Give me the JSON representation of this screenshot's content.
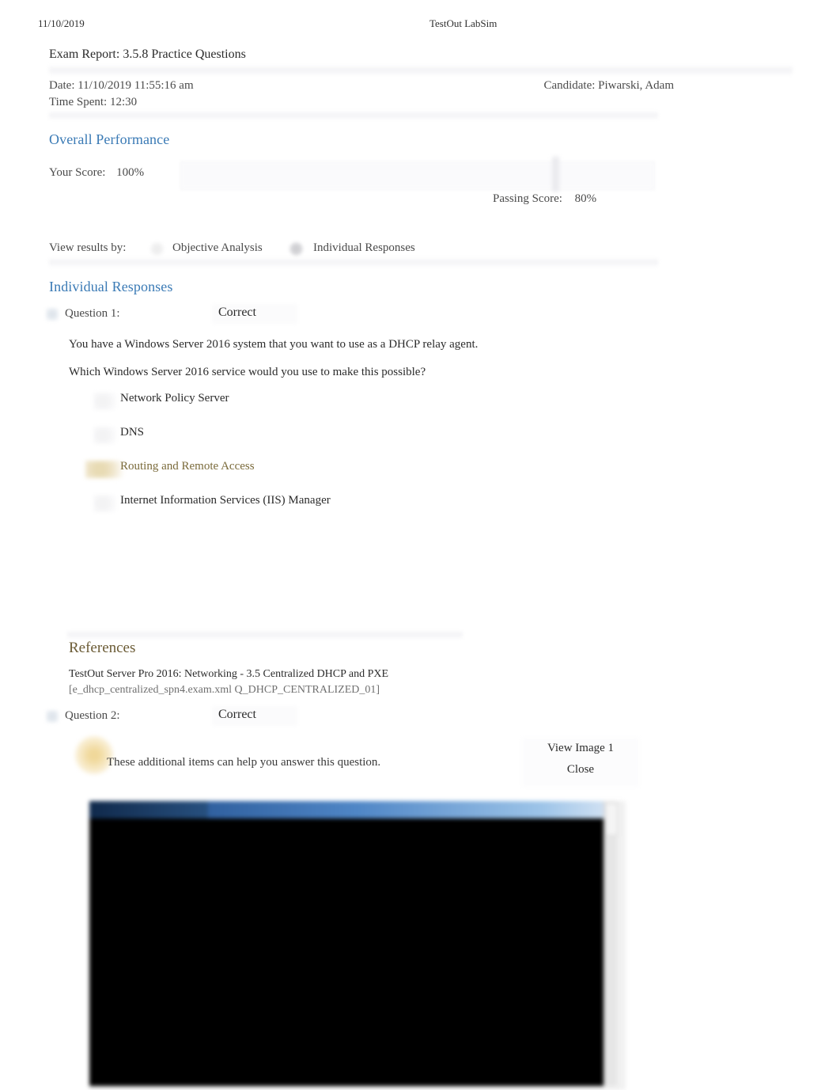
{
  "print_header": {
    "date": "11/10/2019",
    "app_title": "TestOut LabSim"
  },
  "report": {
    "title": "Exam Report: 3.5.8 Practice Questions",
    "date_label": "Date: 11/10/2019 11:55:16 am",
    "time_spent_label": "Time Spent: 12:30",
    "candidate_label": "Candidate: Piwarski, Adam"
  },
  "overall_performance": {
    "heading": "Overall Performance",
    "your_score_label": "Your Score:",
    "your_score_value": "100%",
    "passing_score_label": "Passing Score:",
    "passing_score_value": "80%",
    "score_percent": 100,
    "passing_percent": 80
  },
  "view_results_by": {
    "label": "View results by:",
    "options": [
      {
        "label": "Objective Analysis",
        "selected": false
      },
      {
        "label": "Individual Responses",
        "selected": true
      }
    ]
  },
  "individual_responses": {
    "heading": "Individual Responses",
    "questions": [
      {
        "label": "Question 1:",
        "status": "Correct",
        "stem_lines": [
          "You have a Windows Server 2016 system that you want to use as a DHCP relay agent.",
          "Which Windows Server 2016 service would you use to make this possible?"
        ],
        "options": [
          {
            "text": "Network Policy Server",
            "correct": false
          },
          {
            "text": "DNS",
            "correct": false
          },
          {
            "text": "Routing and Remote Access",
            "correct": true
          },
          {
            "text": "Internet Information Services (IIS) Manager",
            "correct": false
          }
        ],
        "references": {
          "heading": "References",
          "line_1": "TestOut Server Pro 2016: Networking - 3.5 Centralized DHCP and PXE",
          "line_2": "[e_dhcp_centralized_spn4.exam.xml Q_DHCP_CENTRALIZED_01]"
        }
      },
      {
        "label": "Question 2:",
        "status": "Correct",
        "additional_items": {
          "text": "These additional items can help you answer this question.",
          "view_image_label": "View Image 1",
          "close_label": "Close"
        },
        "embedded_image": {
          "kind": "console-screenshot",
          "title_bar_text": "",
          "body_text": "                                                                \n                                                                \n                                                                \n                                                                \n                                                                \n                                                                \n                                                                \n                                                                \n                                                                \n                                                                \n                                                                \n                                                                \n                                                                \n                                                                \n                                                                \n                                                                \n                                                                \n                                                                \n                                                                \n                                                                \n                                                                "
        }
      }
    ]
  },
  "colors": {
    "heading_blue": "#3a7ab5",
    "correct_answer_brown": "#7a6a3a",
    "references_brown": "#6b5b35",
    "body_text": "#2b2b2b",
    "muted_text": "#6f6f6f",
    "console_background": "#000000",
    "console_titlebar": "#2f5f9e"
  }
}
